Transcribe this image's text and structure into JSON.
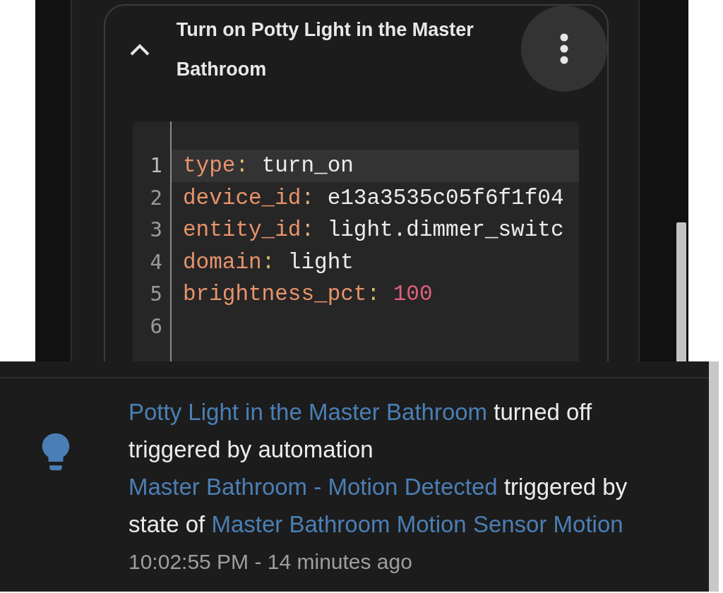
{
  "action_card": {
    "title": "Turn on Potty Light in the Master Bathroom",
    "expanded": true,
    "code_lines": [
      {
        "number": "1",
        "key": "type",
        "colon": ":",
        "value": "turn_on",
        "kind": "string",
        "active": true
      },
      {
        "number": "2",
        "key": "device_id",
        "colon": ":",
        "value": "e13a3535c05f6f1f04",
        "kind": "string",
        "active": false
      },
      {
        "number": "3",
        "key": "entity_id",
        "colon": ":",
        "value": "light.dimmer_switc",
        "kind": "string",
        "active": false
      },
      {
        "number": "4",
        "key": "domain",
        "colon": ":",
        "value": "light",
        "kind": "string",
        "active": false
      },
      {
        "number": "5",
        "key": "brightness_pct",
        "colon": ":",
        "value": "100",
        "kind": "number",
        "active": false
      },
      {
        "number": "6",
        "active": false
      }
    ]
  },
  "logbook_entry": {
    "message": [
      {
        "kind": "link",
        "text": "Potty Light in the Master Bathroom"
      },
      {
        "kind": "text",
        "text": "turned off triggered by automation"
      },
      {
        "kind": "link",
        "text": "Master Bathroom - Motion Detected"
      },
      {
        "kind": "text",
        "text": "triggered by state of"
      },
      {
        "kind": "link",
        "text": "Master Bathroom Motion Sensor Motion"
      }
    ],
    "time": "10:02:55 PM - 14 minutes ago"
  }
}
